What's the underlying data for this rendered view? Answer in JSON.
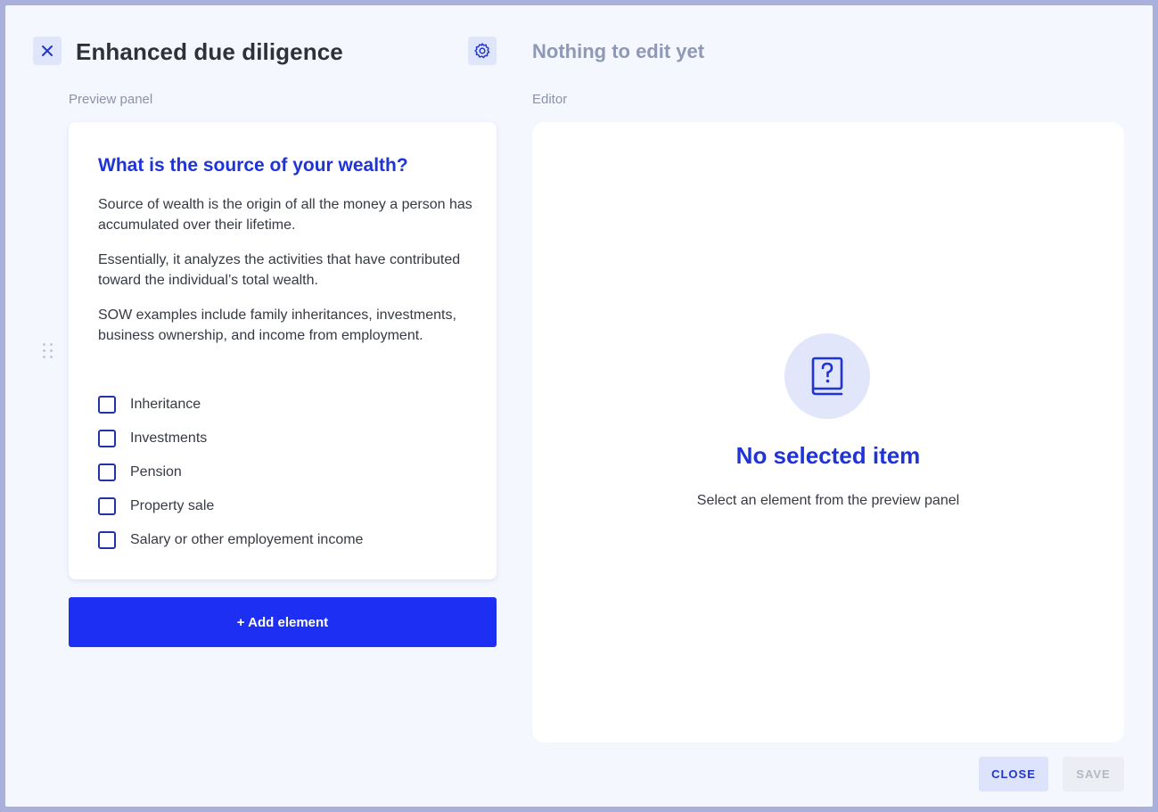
{
  "header": {
    "title": "Enhanced due diligence",
    "editor_title": "Nothing to edit yet"
  },
  "labels": {
    "preview_panel": "Preview panel",
    "editor": "Editor"
  },
  "preview": {
    "question": "What is the source of your wealth?",
    "paragraphs": [
      "Source of wealth is the origin of all the money a person has accumulated over their lifetime.",
      "Essentially, it analyzes the activities that have contributed toward the individual’s total wealth.",
      "SOW examples include family inheritances, investments, business ownership, and income from employment."
    ],
    "options": [
      {
        "label": "Inheritance",
        "checked": false
      },
      {
        "label": "Investments",
        "checked": false
      },
      {
        "label": "Pension",
        "checked": false
      },
      {
        "label": "Property sale",
        "checked": false
      },
      {
        "label": "Salary or other employement income",
        "checked": false
      }
    ]
  },
  "add_element_label": "+ Add element",
  "editor_panel": {
    "icon": "question-book-icon",
    "empty_title": "No selected item",
    "empty_subtitle": "Select an element from the preview panel"
  },
  "footer": {
    "close_label": "CLOSE",
    "save_label": "SAVE",
    "save_disabled": true
  },
  "colors": {
    "accent": "#1c2ff2",
    "accent_text": "#1f34d8",
    "modal_bg": "#f4f7fe",
    "overlay": "#a9b0dc"
  }
}
